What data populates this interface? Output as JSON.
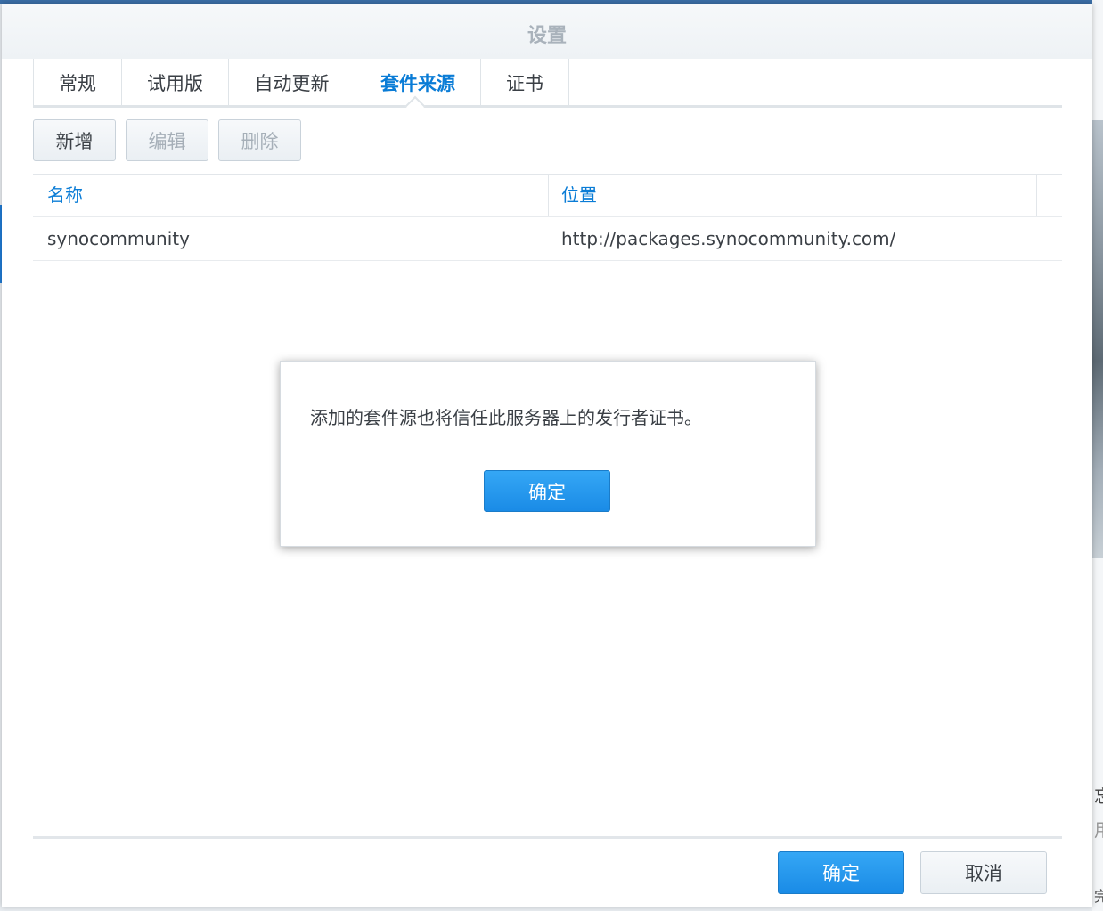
{
  "background": {
    "side_chars": [
      "忘",
      "用",
      "完"
    ]
  },
  "window": {
    "title": "设置"
  },
  "tabs": [
    {
      "label": "常规",
      "active": false
    },
    {
      "label": "试用版",
      "active": false
    },
    {
      "label": "自动更新",
      "active": false
    },
    {
      "label": "套件来源",
      "active": true
    },
    {
      "label": "证书",
      "active": false
    }
  ],
  "toolbar": {
    "add_label": "新增",
    "edit_label": "编辑",
    "delete_label": "删除"
  },
  "grid": {
    "columns": [
      "名称",
      "位置"
    ],
    "rows": [
      {
        "name": "synocommunity",
        "location": "http://packages.synocommunity.com/"
      }
    ]
  },
  "dialog": {
    "message": "添加的套件源也将信任此服务器上的发行者证书。",
    "ok_label": "确定"
  },
  "footer": {
    "ok_label": "确定",
    "cancel_label": "取消"
  },
  "colors": {
    "accent": "#0a7cd6",
    "primary_button": "#1a8be6",
    "title_text": "#a9b2bb"
  }
}
